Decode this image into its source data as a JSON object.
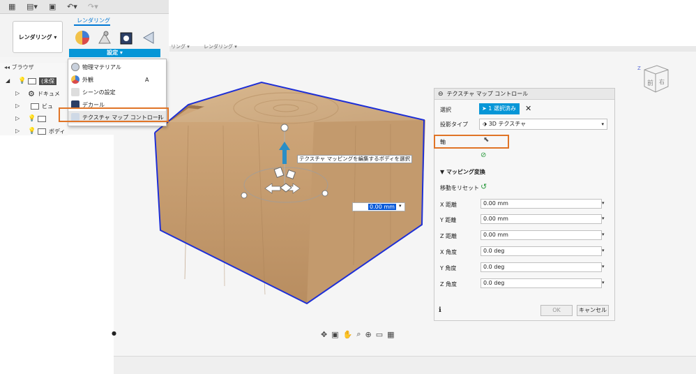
{
  "ribbon": {
    "workspace": "レンダリング ▾",
    "tab_label": "レンダリング",
    "settings_label": "設定 ▾",
    "faded_tab1": "リング ▾",
    "faded_tab2": "レンダリング ▾"
  },
  "menu": {
    "items": [
      {
        "label": "物理マテリアル",
        "icon": "material-sphere-icon"
      },
      {
        "label": "外観",
        "icon": "appearance-icon",
        "shortcut": "A"
      },
      {
        "label": "シーンの設定",
        "icon": "scene-settings-icon"
      },
      {
        "label": "デカール",
        "icon": "decal-icon"
      },
      {
        "label": "テクスチャ マップ コントロール",
        "icon": "texture-map-icon"
      }
    ]
  },
  "browser": {
    "header": "ブラウザ",
    "rows": [
      {
        "label": "(未保"
      },
      {
        "label": "ドキュメ"
      },
      {
        "label": "ビュ"
      },
      {
        "label": ""
      },
      {
        "label": "ボディ"
      }
    ]
  },
  "viewport": {
    "tooltip": "テクスチャ マッピングを編集するボディを選択",
    "distance_value": "0.00 mm",
    "navcube_front": "前",
    "navcube_right": "右"
  },
  "panel": {
    "title": "テクスチャ マップ コントロール",
    "select_label": "選択",
    "select_button": "1 選択済み",
    "projection_label": "投影タイプ",
    "projection_value": "3D テクスチャ",
    "axis_label": "軸",
    "section_title": "マッピング変換",
    "reset_label": "移動をリセット",
    "fields": [
      {
        "label": "X 距離",
        "value": "0.00 mm"
      },
      {
        "label": "Y 距離",
        "value": "0.00 mm"
      },
      {
        "label": "Z 距離",
        "value": "0.00 mm"
      },
      {
        "label": "X 角度",
        "value": "0.0 deg"
      },
      {
        "label": "Y 角度",
        "value": "0.0 deg"
      },
      {
        "label": "Z 角度",
        "value": "0.0 deg"
      }
    ],
    "ok_label": "OK",
    "cancel_label": "キャンセル"
  },
  "colors": {
    "accent": "#0696d7",
    "highlight": "#e07426",
    "wood": "#c9a57c",
    "edge": "#1e2fd6"
  }
}
